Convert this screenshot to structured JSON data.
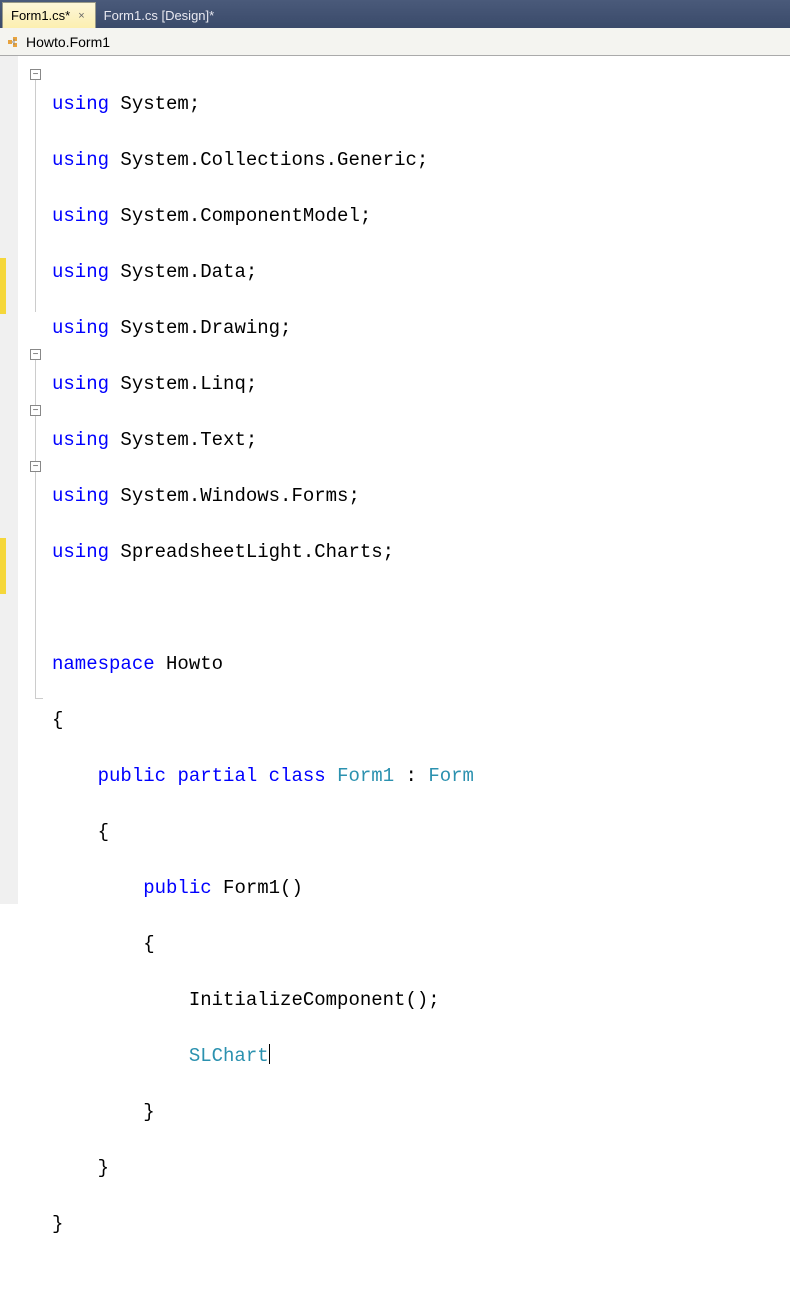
{
  "tabs": {
    "active": {
      "label": "Form1.cs*",
      "close": "×"
    },
    "inactive": {
      "label": "Form1.cs [Design]*"
    }
  },
  "breadcrumb": {
    "label": "Howto.Form1"
  },
  "kw": {
    "using": "using",
    "namespace": "namespace",
    "public": "public",
    "partial": "partial",
    "class": "class"
  },
  "code": {
    "l1": "System;",
    "l2": "System.Collections.Generic;",
    "l3": "System.ComponentModel;",
    "l4": "System.Data;",
    "l5": "System.Drawing;",
    "l6": "System.Linq;",
    "l7": "System.Text;",
    "l8": "System.Windows.Forms;",
    "l9": "SpreadsheetLight.Charts;",
    "ns": "Howto",
    "braceOpen": "{",
    "braceClose": "}",
    "classname": "Form1",
    "colon": " : ",
    "baseclass": "Form",
    "ctor": "Form1()",
    "init": "InitializeComponent();",
    "slchart": "SLChart"
  },
  "foldGlyph": "−"
}
